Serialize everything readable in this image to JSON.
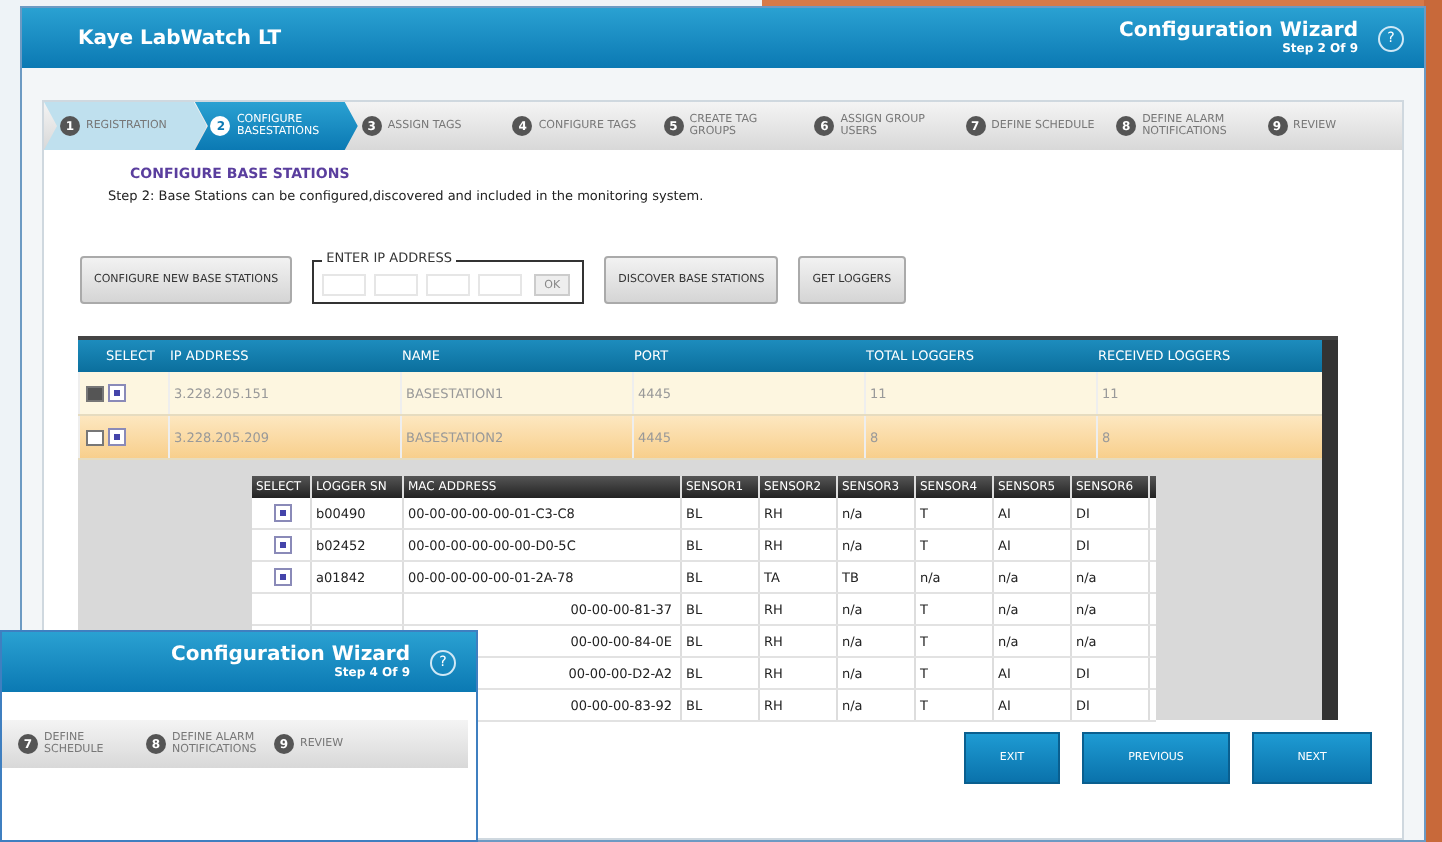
{
  "window": {
    "app_title": "Kaye LabWatch LT",
    "wizard_title": "Configuration Wizard",
    "step_of": "Step 2 Of 9",
    "help": "?"
  },
  "steps": [
    {
      "number": "1",
      "label": "REGISTRATION",
      "selected": false,
      "completed": true
    },
    {
      "number": "2",
      "label": "CONFIGURE BASESTATIONS",
      "selected": true,
      "completed": false
    },
    {
      "number": "3",
      "label": "ASSIGN TAGS",
      "selected": false,
      "completed": false
    },
    {
      "number": "4",
      "label": "CONFIGURE TAGS",
      "selected": false,
      "completed": false
    },
    {
      "number": "5",
      "label": "CREATE TAG GROUPS",
      "selected": false,
      "completed": false
    },
    {
      "number": "6",
      "label": "ASSIGN GROUP USERS",
      "selected": false,
      "completed": false
    },
    {
      "number": "7",
      "label": "DEFINE SCHEDULE",
      "selected": false,
      "completed": false
    },
    {
      "number": "8",
      "label": "DEFINE ALARM NOTIFICATIONS",
      "selected": false,
      "completed": false
    },
    {
      "number": "9",
      "label": "REVIEW",
      "selected": false,
      "completed": false
    }
  ],
  "section_title": "CONFIGURE BASE STATIONS",
  "description": "Step 2: Base Stations can be configured,discovered and included in the monitoring system.",
  "actions": {
    "configure_new": "CONFIGURE NEW BASE STATIONS",
    "ip_legend": "ENTER IP ADDRESS",
    "ok": "OK",
    "discover": "DISCOVER BASE STATIONS",
    "get_loggers": "GET LOGGERS"
  },
  "table": {
    "select_header": "SELECT",
    "columns": [
      "IP ADDRESS",
      "NAME",
      "PORT",
      "TOTAL LOGGERS",
      "RECEIVED LOGGERS"
    ],
    "rows": [
      {
        "expanded": true,
        "checked": true,
        "selected": false,
        "cells": [
          "3.228.205.151",
          "BASESTATION1",
          "4445",
          "11",
          "11"
        ]
      },
      {
        "expanded": false,
        "checked": true,
        "selected": true,
        "cells": [
          "3.228.205.209",
          "BASESTATION2",
          "4445",
          "8",
          "8"
        ]
      }
    ]
  },
  "loggers": {
    "columns": [
      "SELECT",
      "LOGGER SN",
      "MAC ADDRESS",
      "SENSOR1",
      "SENSOR2",
      "SENSOR3",
      "SENSOR4",
      "SENSOR5",
      "SENSOR6"
    ],
    "rows": [
      {
        "checked": true,
        "sn": "b00490",
        "mac": "00-00-00-00-00-01-C3-C8",
        "sensors": [
          "BL",
          "RH",
          "n/a",
          "T",
          "AI",
          "DI"
        ]
      },
      {
        "checked": true,
        "sn": "b02452",
        "mac": "00-00-00-00-00-00-D0-5C",
        "sensors": [
          "BL",
          "RH",
          "n/a",
          "T",
          "AI",
          "DI"
        ]
      },
      {
        "checked": true,
        "sn": "a01842",
        "mac": "00-00-00-00-00-01-2A-78",
        "sensors": [
          "BL",
          "TA",
          "TB",
          "n/a",
          "n/a",
          "n/a"
        ]
      },
      {
        "mac": "00-00-00-81-37",
        "sensors": [
          "BL",
          "RH",
          "n/a",
          "T",
          "n/a",
          "n/a"
        ]
      },
      {
        "mac": "00-00-00-84-0E",
        "sensors": [
          "BL",
          "RH",
          "n/a",
          "T",
          "n/a",
          "n/a"
        ]
      },
      {
        "mac": "00-00-00-D2-A2",
        "sensors": [
          "BL",
          "RH",
          "n/a",
          "T",
          "AI",
          "DI"
        ]
      },
      {
        "mac": "00-00-00-83-92",
        "sensors": [
          "BL",
          "RH",
          "n/a",
          "T",
          "AI",
          "DI"
        ]
      }
    ]
  },
  "footer_buttons": [
    "EXIT",
    "PREVIOUS",
    "NEXT"
  ],
  "front_window": {
    "wizard_title": "Configuration Wizard",
    "step_of": "Step 4 Of 9",
    "help": "?",
    "steps": [
      {
        "number": "7",
        "label": "DEFINE SCHEDULE"
      },
      {
        "number": "8",
        "label": "DEFINE ALARM NOTIFICATIONS"
      },
      {
        "number": "9",
        "label": "REVIEW"
      }
    ]
  }
}
